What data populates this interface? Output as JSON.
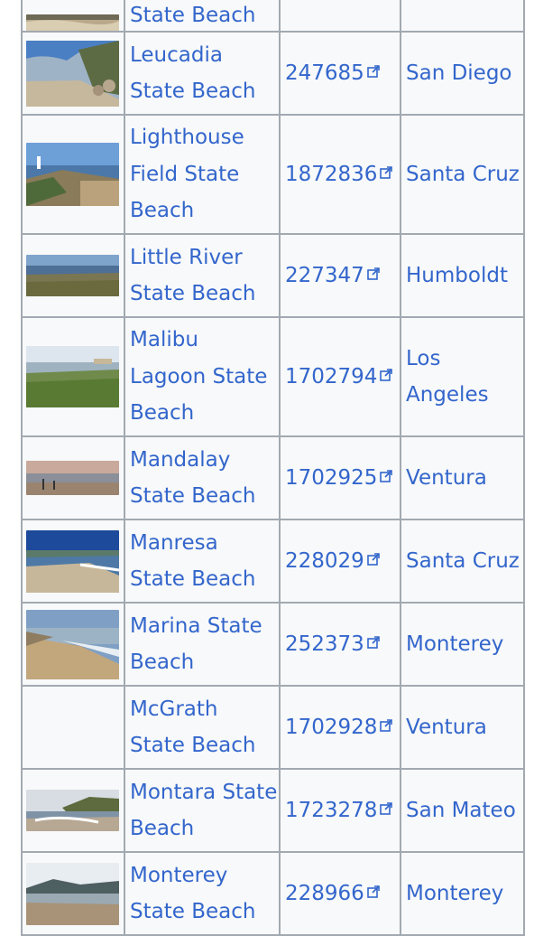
{
  "rows": [
    {
      "name": "State Beach",
      "id": "",
      "county": "",
      "thumb": "partial-beach"
    },
    {
      "name": "Leucadia State Beach",
      "id": "247685",
      "county": "San Diego",
      "thumb": "leucadia"
    },
    {
      "name": "Lighthouse Field State Beach",
      "id": "1872836",
      "county": "Santa Cruz",
      "thumb": "lighthouse"
    },
    {
      "name": "Little River State Beach",
      "id": "227347",
      "county": "Humboldt",
      "thumb": "little-river"
    },
    {
      "name": "Malibu Lagoon State Beach",
      "id": "1702794",
      "county": "Los Angeles",
      "thumb": "malibu"
    },
    {
      "name": "Mandalay State Beach",
      "id": "1702925",
      "county": "Ventura",
      "thumb": "mandalay"
    },
    {
      "name": "Manresa State Beach",
      "id": "228029",
      "county": "Santa Cruz",
      "thumb": "manresa"
    },
    {
      "name": "Marina State Beach",
      "id": "252373",
      "county": "Monterey",
      "thumb": "marina"
    },
    {
      "name": "McGrath State Beach",
      "id": "1702928",
      "county": "Ventura",
      "thumb": ""
    },
    {
      "name": "Montara State Beach",
      "id": "1723278",
      "county": "San Mateo",
      "thumb": "montara"
    },
    {
      "name": "Monterey State Beach",
      "id": "228966",
      "county": "Monterey",
      "thumb": "monterey"
    }
  ],
  "colors": {
    "link": "#3366cc",
    "border": "#a2a9b1",
    "cell_bg": "#f8f9fa"
  }
}
